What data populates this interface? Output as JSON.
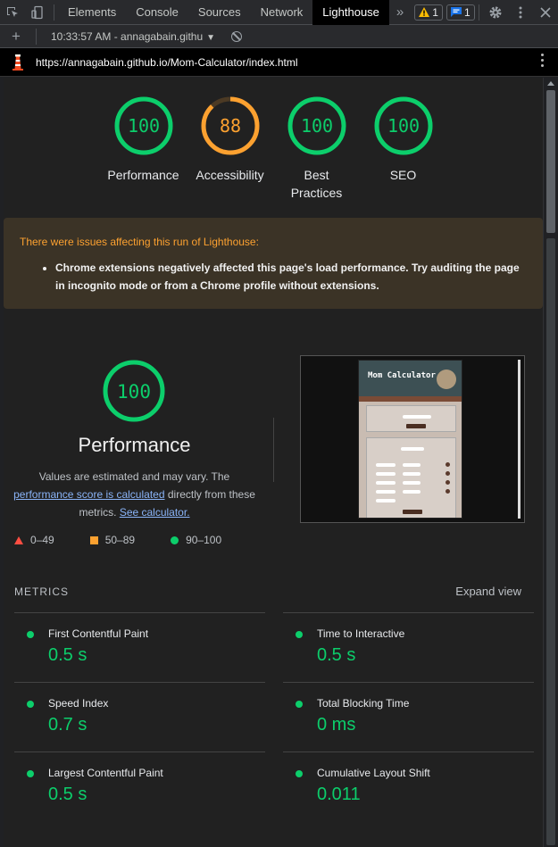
{
  "devtools": {
    "tabs": [
      "Elements",
      "Console",
      "Sources",
      "Network",
      "Lighthouse"
    ],
    "active_tab": "Lighthouse",
    "more_tabs": "»",
    "warnings_count": "1",
    "messages_count": "1"
  },
  "session": {
    "label": "10:33:57 AM - annagabain.githu"
  },
  "report_url": "https://annagabain.github.io/Mom-Calculator/index.html",
  "gauges": [
    {
      "score": "100",
      "label": "Performance",
      "color": "#0cce6b",
      "fraction": 1.0
    },
    {
      "score": "88",
      "label": "Accessibility",
      "color": "#fca130",
      "fraction": 0.88
    },
    {
      "score": "100",
      "label": "Best Practices",
      "color": "#0cce6b",
      "fraction": 1.0
    },
    {
      "score": "100",
      "label": "SEO",
      "color": "#0cce6b",
      "fraction": 1.0
    }
  ],
  "warning": {
    "title": "There were issues affecting this run of Lighthouse:",
    "items": [
      "Chrome extensions negatively affected this page's load performance. Try auditing the page in incognito mode or from a Chrome profile without extensions."
    ]
  },
  "performance": {
    "score": "100",
    "title": "Performance",
    "desc_1": "Values are estimated and may vary. The",
    "link_1": "performance score is calculated",
    "desc_2": "directly from these metrics.",
    "link_2": "See calculator.",
    "legend": [
      "0–49",
      "50–89",
      "90–100"
    ]
  },
  "screenshot": {
    "app_title": "Mom Calculator"
  },
  "metrics_section": {
    "label": "METRICS",
    "expand": "Expand view",
    "items": [
      {
        "name": "First Contentful Paint",
        "value": "0.5 s"
      },
      {
        "name": "Time to Interactive",
        "value": "0.5 s"
      },
      {
        "name": "Speed Index",
        "value": "0.7 s"
      },
      {
        "name": "Total Blocking Time",
        "value": "0 ms"
      },
      {
        "name": "Largest Contentful Paint",
        "value": "0.5 s"
      },
      {
        "name": "Cumulative Layout Shift",
        "value": "0.011"
      }
    ]
  },
  "colors": {
    "pass": "#0cce6b",
    "average": "#fca130",
    "fail": "#ff4e42"
  }
}
